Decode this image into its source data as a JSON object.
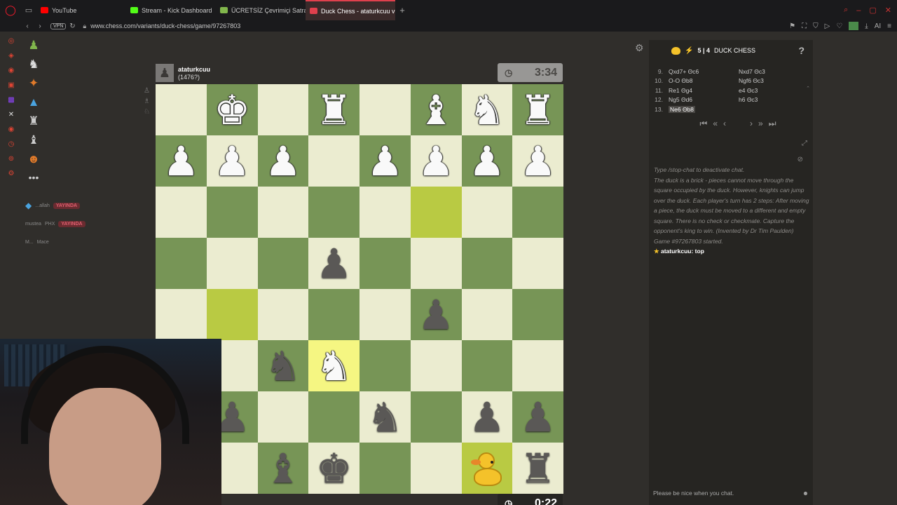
{
  "browser": {
    "tabs": [
      {
        "label": "YouTube",
        "icon": "youtube-icon",
        "color": "#ff0000"
      },
      {
        "label": "Stream - Kick Dashboard",
        "icon": "kick-icon",
        "color": "#53fc18"
      },
      {
        "label": "ÜCRETSİZ Çevrimiçi Satra",
        "icon": "chess-icon",
        "color": "#81b64c"
      },
      {
        "label": "Duck Chess - ataturkcuu v",
        "icon": "chess-icon",
        "color": "#e0404d"
      }
    ],
    "vpn_label": "VPN",
    "url": "www.chess.com/variants/duck-chess/game/97267803"
  },
  "streams": [
    {
      "name": "...allah",
      "badge": "YAYINDA"
    },
    {
      "name": "mustea",
      "extra": "PHX",
      "badge": "YAYINDA"
    },
    {
      "name": "M...",
      "extra": "Mace"
    }
  ],
  "opponent": {
    "name": "ataturkcuu",
    "rating": "(1476?)",
    "clock": "3:34"
  },
  "player": {
    "clock": "0:22"
  },
  "colors": {
    "light_square": "#ebecd0",
    "dark_square": "#779556",
    "highlight_light": "#f5f682",
    "highlight_dark": "#b9ca43",
    "accent": "#e0404d"
  },
  "board": [
    [
      "",
      "wK",
      "",
      "wR",
      "",
      "wB",
      "wN",
      "wR"
    ],
    [
      "wP",
      "wP",
      "wP",
      "",
      "wP",
      "wP",
      "wP",
      "wP"
    ],
    [
      "",
      "",
      "",
      "",
      "",
      "hl",
      "",
      ""
    ],
    [
      "",
      "",
      "",
      "bP",
      "",
      "",
      "",
      ""
    ],
    [
      "",
      "hl",
      "",
      "",
      "",
      "bP",
      "",
      ""
    ],
    [
      "",
      "",
      "bN",
      "wN*",
      "",
      "",
      "",
      ""
    ],
    [
      "",
      "bP",
      "",
      "",
      "bN",
      "",
      "bP",
      "bP"
    ],
    [
      "",
      "",
      "bB",
      "bK",
      "",
      "",
      "duck",
      "bR"
    ]
  ],
  "panel": {
    "time_control": "5 | 4",
    "mode": "DUCK CHESS",
    "help": "?",
    "moves": [
      {
        "num": "9.",
        "w": "Qxd7+ Θc6",
        "b": "Nxd7 Θc3"
      },
      {
        "num": "10.",
        "w": "O-O Θb8",
        "b": "Ngf6 Θc3"
      },
      {
        "num": "11.",
        "w": "Re1 Θg4",
        "b": "e4 Θc3"
      },
      {
        "num": "12.",
        "w": "Ng5 Θd6",
        "b": "h6 Θc3"
      },
      {
        "num": "13.",
        "w": "Ne6 Θb8",
        "b": ""
      }
    ],
    "chat": {
      "hints": [
        "Type /stop-chat to deactivate chat.",
        "The duck is a brick - pieces cannot move through the square occupied by the duck. However, knights can jump over the duck. Each player's turn has 2 steps: After moving a piece, the duck must be moved to a different and empty square. There is no check or checkmate. Capture the opponent's king to win. (Invented by Dr Tim Paulden)",
        "Game #97267803 started."
      ],
      "message": {
        "user": "ataturkcuu",
        "text": "top"
      },
      "input_placeholder": "Please be nice when you chat."
    }
  }
}
